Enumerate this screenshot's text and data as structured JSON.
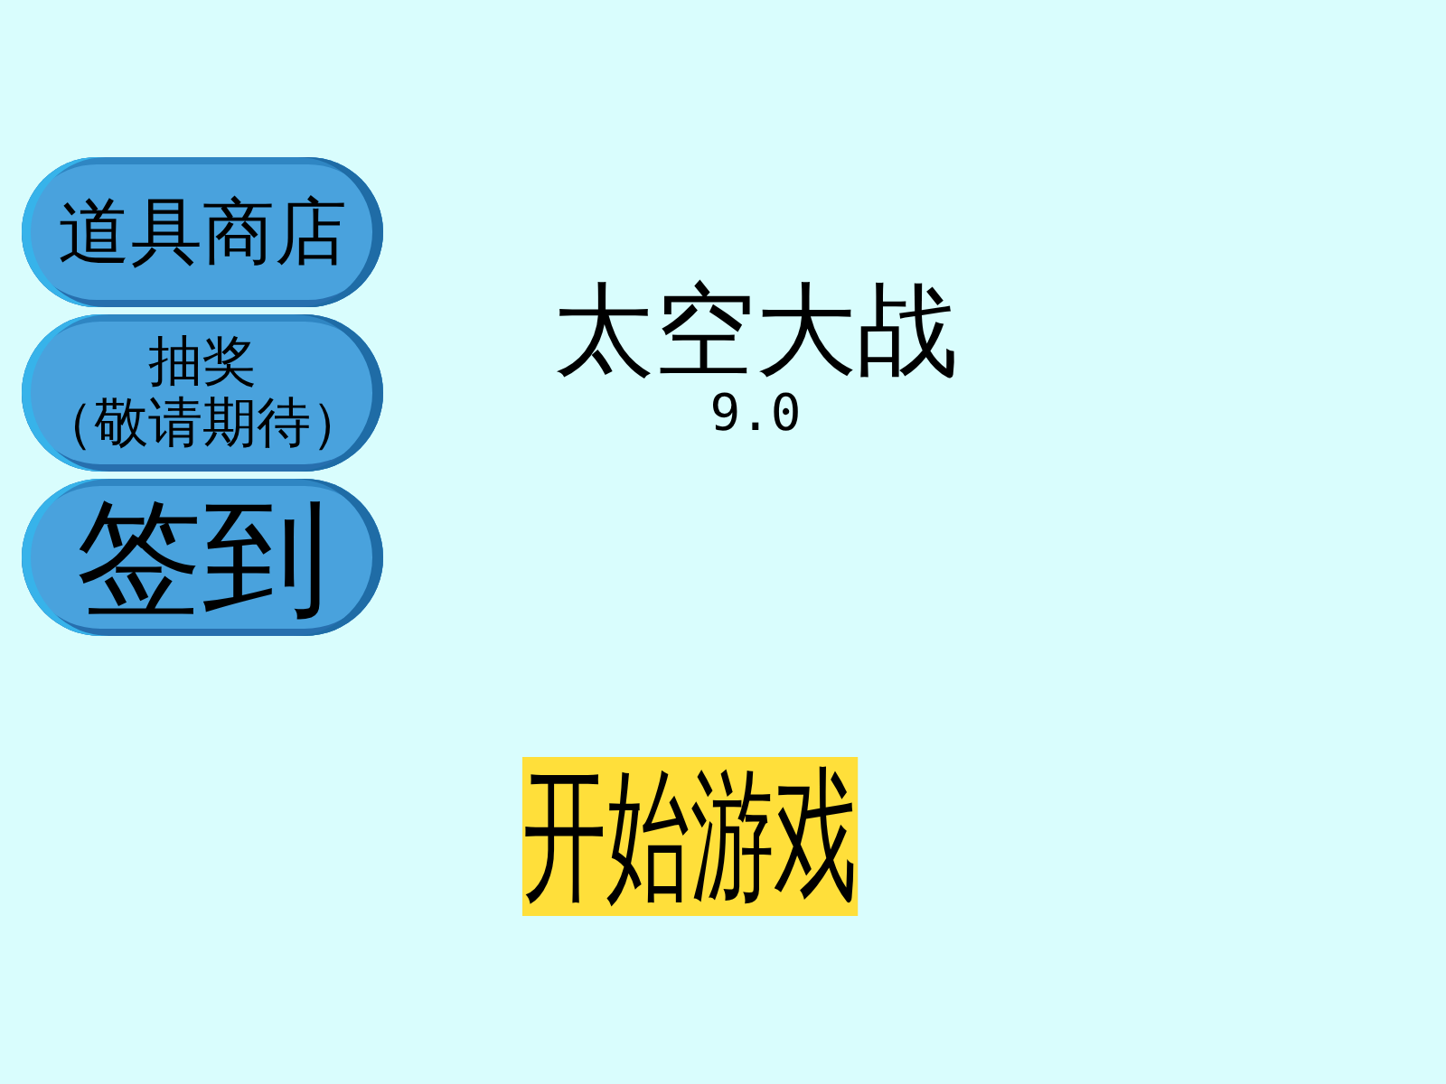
{
  "side_buttons": [
    {
      "label": "道具商店"
    },
    {
      "label": "抽奖",
      "note": "（敬请期待）"
    },
    {
      "label": "签到"
    }
  ],
  "title": "太空大战",
  "version": "9.0",
  "start_button": "开始游戏"
}
